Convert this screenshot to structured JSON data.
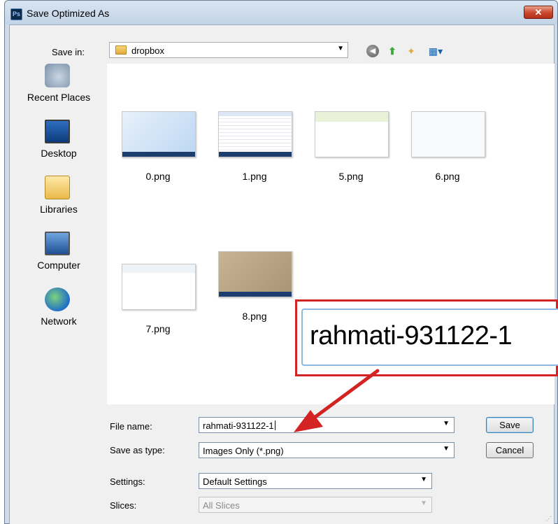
{
  "window": {
    "title": "Save Optimized As",
    "app_icon_text": "Ps",
    "close_symbol": "✕"
  },
  "toolbar": {
    "save_in_label": "Save in:",
    "save_in_value": "dropbox",
    "icons": [
      "back-icon",
      "up-folder-icon",
      "new-folder-icon",
      "views-menu-icon"
    ]
  },
  "places": [
    {
      "label": "Recent Places",
      "icon": "recent-places-icon"
    },
    {
      "label": "Desktop",
      "icon": "desktop-icon"
    },
    {
      "label": "Libraries",
      "icon": "libraries-icon"
    },
    {
      "label": "Computer",
      "icon": "computer-icon"
    },
    {
      "label": "Network",
      "icon": "network-icon"
    }
  ],
  "files": [
    {
      "name": "0.png"
    },
    {
      "name": "1.png"
    },
    {
      "name": "5.png"
    },
    {
      "name": "6.png"
    },
    {
      "name": "7.png"
    },
    {
      "name": "8.png"
    }
  ],
  "callout": {
    "zoom_text": "rahmati-931122-1",
    "border_color": "#d32323"
  },
  "form": {
    "file_name_label": "File name:",
    "file_name_value": "rahmati-931122-1",
    "save_as_type_label": "Save as type:",
    "save_as_type_value": "Images Only (*.png)",
    "settings_label": "Settings:",
    "settings_value": "Default Settings",
    "slices_label": "Slices:",
    "slices_value": "All Slices"
  },
  "buttons": {
    "save": "Save",
    "cancel": "Cancel"
  }
}
